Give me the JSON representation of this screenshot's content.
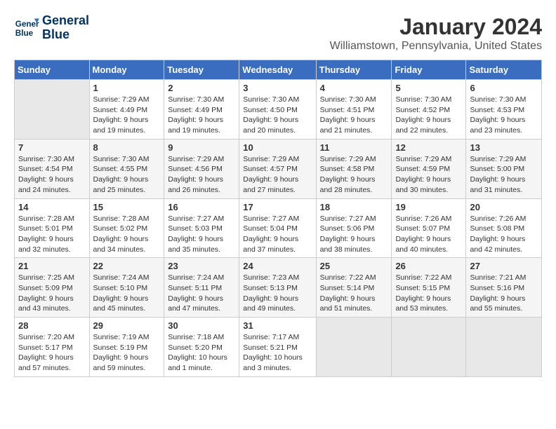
{
  "logo": {
    "line1": "General",
    "line2": "Blue"
  },
  "title": "January 2024",
  "location": "Williamstown, Pennsylvania, United States",
  "days_header": [
    "Sunday",
    "Monday",
    "Tuesday",
    "Wednesday",
    "Thursday",
    "Friday",
    "Saturday"
  ],
  "weeks": [
    [
      {
        "num": "",
        "sunrise": "",
        "sunset": "",
        "daylight": "",
        "empty": true
      },
      {
        "num": "1",
        "sunrise": "Sunrise: 7:29 AM",
        "sunset": "Sunset: 4:49 PM",
        "daylight": "Daylight: 9 hours and 19 minutes."
      },
      {
        "num": "2",
        "sunrise": "Sunrise: 7:30 AM",
        "sunset": "Sunset: 4:49 PM",
        "daylight": "Daylight: 9 hours and 19 minutes."
      },
      {
        "num": "3",
        "sunrise": "Sunrise: 7:30 AM",
        "sunset": "Sunset: 4:50 PM",
        "daylight": "Daylight: 9 hours and 20 minutes."
      },
      {
        "num": "4",
        "sunrise": "Sunrise: 7:30 AM",
        "sunset": "Sunset: 4:51 PM",
        "daylight": "Daylight: 9 hours and 21 minutes."
      },
      {
        "num": "5",
        "sunrise": "Sunrise: 7:30 AM",
        "sunset": "Sunset: 4:52 PM",
        "daylight": "Daylight: 9 hours and 22 minutes."
      },
      {
        "num": "6",
        "sunrise": "Sunrise: 7:30 AM",
        "sunset": "Sunset: 4:53 PM",
        "daylight": "Daylight: 9 hours and 23 minutes."
      }
    ],
    [
      {
        "num": "7",
        "sunrise": "Sunrise: 7:30 AM",
        "sunset": "Sunset: 4:54 PM",
        "daylight": "Daylight: 9 hours and 24 minutes."
      },
      {
        "num": "8",
        "sunrise": "Sunrise: 7:30 AM",
        "sunset": "Sunset: 4:55 PM",
        "daylight": "Daylight: 9 hours and 25 minutes."
      },
      {
        "num": "9",
        "sunrise": "Sunrise: 7:29 AM",
        "sunset": "Sunset: 4:56 PM",
        "daylight": "Daylight: 9 hours and 26 minutes."
      },
      {
        "num": "10",
        "sunrise": "Sunrise: 7:29 AM",
        "sunset": "Sunset: 4:57 PM",
        "daylight": "Daylight: 9 hours and 27 minutes."
      },
      {
        "num": "11",
        "sunrise": "Sunrise: 7:29 AM",
        "sunset": "Sunset: 4:58 PM",
        "daylight": "Daylight: 9 hours and 28 minutes."
      },
      {
        "num": "12",
        "sunrise": "Sunrise: 7:29 AM",
        "sunset": "Sunset: 4:59 PM",
        "daylight": "Daylight: 9 hours and 30 minutes."
      },
      {
        "num": "13",
        "sunrise": "Sunrise: 7:29 AM",
        "sunset": "Sunset: 5:00 PM",
        "daylight": "Daylight: 9 hours and 31 minutes."
      }
    ],
    [
      {
        "num": "14",
        "sunrise": "Sunrise: 7:28 AM",
        "sunset": "Sunset: 5:01 PM",
        "daylight": "Daylight: 9 hours and 32 minutes."
      },
      {
        "num": "15",
        "sunrise": "Sunrise: 7:28 AM",
        "sunset": "Sunset: 5:02 PM",
        "daylight": "Daylight: 9 hours and 34 minutes."
      },
      {
        "num": "16",
        "sunrise": "Sunrise: 7:27 AM",
        "sunset": "Sunset: 5:03 PM",
        "daylight": "Daylight: 9 hours and 35 minutes."
      },
      {
        "num": "17",
        "sunrise": "Sunrise: 7:27 AM",
        "sunset": "Sunset: 5:04 PM",
        "daylight": "Daylight: 9 hours and 37 minutes."
      },
      {
        "num": "18",
        "sunrise": "Sunrise: 7:27 AM",
        "sunset": "Sunset: 5:06 PM",
        "daylight": "Daylight: 9 hours and 38 minutes."
      },
      {
        "num": "19",
        "sunrise": "Sunrise: 7:26 AM",
        "sunset": "Sunset: 5:07 PM",
        "daylight": "Daylight: 9 hours and 40 minutes."
      },
      {
        "num": "20",
        "sunrise": "Sunrise: 7:26 AM",
        "sunset": "Sunset: 5:08 PM",
        "daylight": "Daylight: 9 hours and 42 minutes."
      }
    ],
    [
      {
        "num": "21",
        "sunrise": "Sunrise: 7:25 AM",
        "sunset": "Sunset: 5:09 PM",
        "daylight": "Daylight: 9 hours and 43 minutes."
      },
      {
        "num": "22",
        "sunrise": "Sunrise: 7:24 AM",
        "sunset": "Sunset: 5:10 PM",
        "daylight": "Daylight: 9 hours and 45 minutes."
      },
      {
        "num": "23",
        "sunrise": "Sunrise: 7:24 AM",
        "sunset": "Sunset: 5:11 PM",
        "daylight": "Daylight: 9 hours and 47 minutes."
      },
      {
        "num": "24",
        "sunrise": "Sunrise: 7:23 AM",
        "sunset": "Sunset: 5:13 PM",
        "daylight": "Daylight: 9 hours and 49 minutes."
      },
      {
        "num": "25",
        "sunrise": "Sunrise: 7:22 AM",
        "sunset": "Sunset: 5:14 PM",
        "daylight": "Daylight: 9 hours and 51 minutes."
      },
      {
        "num": "26",
        "sunrise": "Sunrise: 7:22 AM",
        "sunset": "Sunset: 5:15 PM",
        "daylight": "Daylight: 9 hours and 53 minutes."
      },
      {
        "num": "27",
        "sunrise": "Sunrise: 7:21 AM",
        "sunset": "Sunset: 5:16 PM",
        "daylight": "Daylight: 9 hours and 55 minutes."
      }
    ],
    [
      {
        "num": "28",
        "sunrise": "Sunrise: 7:20 AM",
        "sunset": "Sunset: 5:17 PM",
        "daylight": "Daylight: 9 hours and 57 minutes."
      },
      {
        "num": "29",
        "sunrise": "Sunrise: 7:19 AM",
        "sunset": "Sunset: 5:19 PM",
        "daylight": "Daylight: 9 hours and 59 minutes."
      },
      {
        "num": "30",
        "sunrise": "Sunrise: 7:18 AM",
        "sunset": "Sunset: 5:20 PM",
        "daylight": "Daylight: 10 hours and 1 minute."
      },
      {
        "num": "31",
        "sunrise": "Sunrise: 7:17 AM",
        "sunset": "Sunset: 5:21 PM",
        "daylight": "Daylight: 10 hours and 3 minutes."
      },
      {
        "num": "",
        "sunrise": "",
        "sunset": "",
        "daylight": "",
        "empty": true
      },
      {
        "num": "",
        "sunrise": "",
        "sunset": "",
        "daylight": "",
        "empty": true
      },
      {
        "num": "",
        "sunrise": "",
        "sunset": "",
        "daylight": "",
        "empty": true
      }
    ]
  ]
}
